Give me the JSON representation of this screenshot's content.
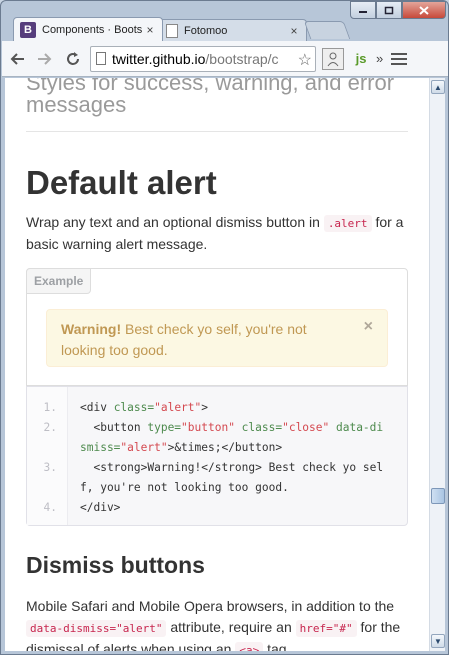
{
  "browser": {
    "tabs": [
      {
        "title": "Components · Boots",
        "close": "×"
      },
      {
        "title": "Fotomoo",
        "close": "×"
      }
    ],
    "favicon_letter": "B",
    "window_buttons": {
      "minimize": "▭",
      "restore": "▢",
      "close": "✕"
    },
    "url_host": "twitter.github.io",
    "url_path": "/bootstrap/c",
    "ext_js": "js",
    "overflow": "»"
  },
  "page": {
    "prev_heading": "Styles for success, warning, and error messages",
    "h1": "Default alert",
    "para1_a": "Wrap any text and an optional dismiss button in ",
    "para1_code": ".alert",
    "para1_b": " for a basic warning alert message.",
    "example_label": "Example",
    "alert_strong": "Warning!",
    "alert_text": " Best check yo self, you're not looking too good.",
    "alert_close": "×",
    "line_numbers": [
      "1.",
      "2.",
      "3.",
      "4."
    ],
    "h2": "Dismiss buttons",
    "para2_a": "Mobile Safari and Mobile Opera browsers, in addition to the ",
    "para2_code1": "data-dismiss=\"alert\"",
    "para2_b": " attribute, require an ",
    "para2_code2": "href=\"#\"",
    "para2_c": " for the dismissal of alerts when using an ",
    "para2_code3": "<a>",
    "para2_d": " tag."
  },
  "code_lines": {
    "l1_tag": "<div ",
    "l1_attr": "class=",
    "l1_val": "\"alert\"",
    "l1_end": ">",
    "l2_tag": "  <button ",
    "l2_attr1": "type=",
    "l2_val1": "\"button\"",
    "l2_attr2": " class=",
    "l2_val2": "\"close\"",
    "l2_attr3": " data-di",
    "l2b_attr": "smiss=",
    "l2b_val": "\"alert\"",
    "l2b_end": ">&times;</button>",
    "l3a": "  <strong>Warning!</strong> Best check yo sel",
    "l3b": "f, you're not looking too good.",
    "l4": "</div>"
  }
}
